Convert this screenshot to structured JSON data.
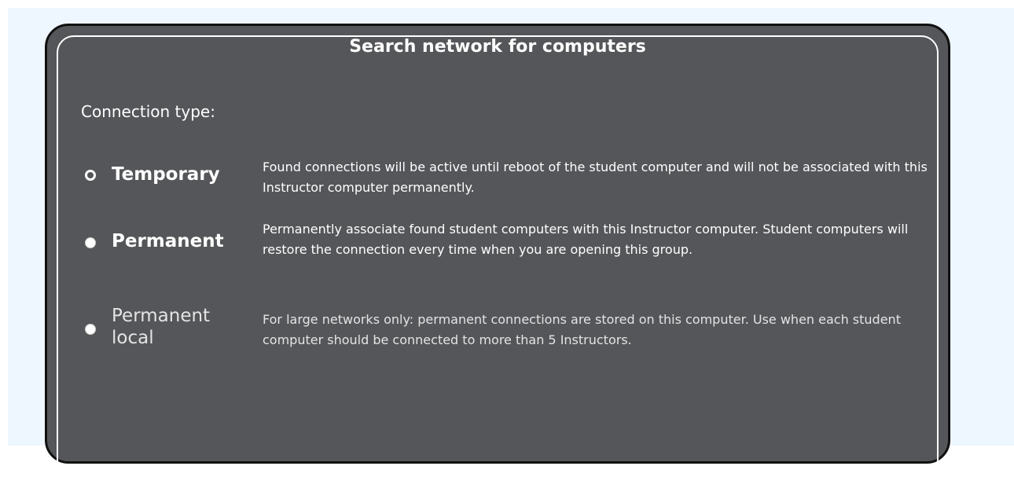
{
  "dialog": {
    "title": "Search network for computers"
  },
  "connection_type": {
    "label": "Connection type:",
    "selected": "Temporary",
    "options": [
      {
        "label": "Temporary",
        "description": "Found connections will be active until reboot of the student computer and will not be associated with this Instructor computer permanently."
      },
      {
        "label": "Permanent",
        "description": "Permanently associate found student computers with this Instructor computer. Student computers will restore the connection every time when you are opening this group."
      },
      {
        "label": "Permanent local",
        "description": "For large networks only: permanent connections are stored on this computer. Use when each student computer should be connected to more than 5 Instructors."
      }
    ]
  },
  "colors": {
    "page_background": "#eef6ff",
    "dialog_background": "#555659",
    "dialog_border": "#111111",
    "text_primary": "#ffffff",
    "text_secondary": "#e4e4e4"
  }
}
